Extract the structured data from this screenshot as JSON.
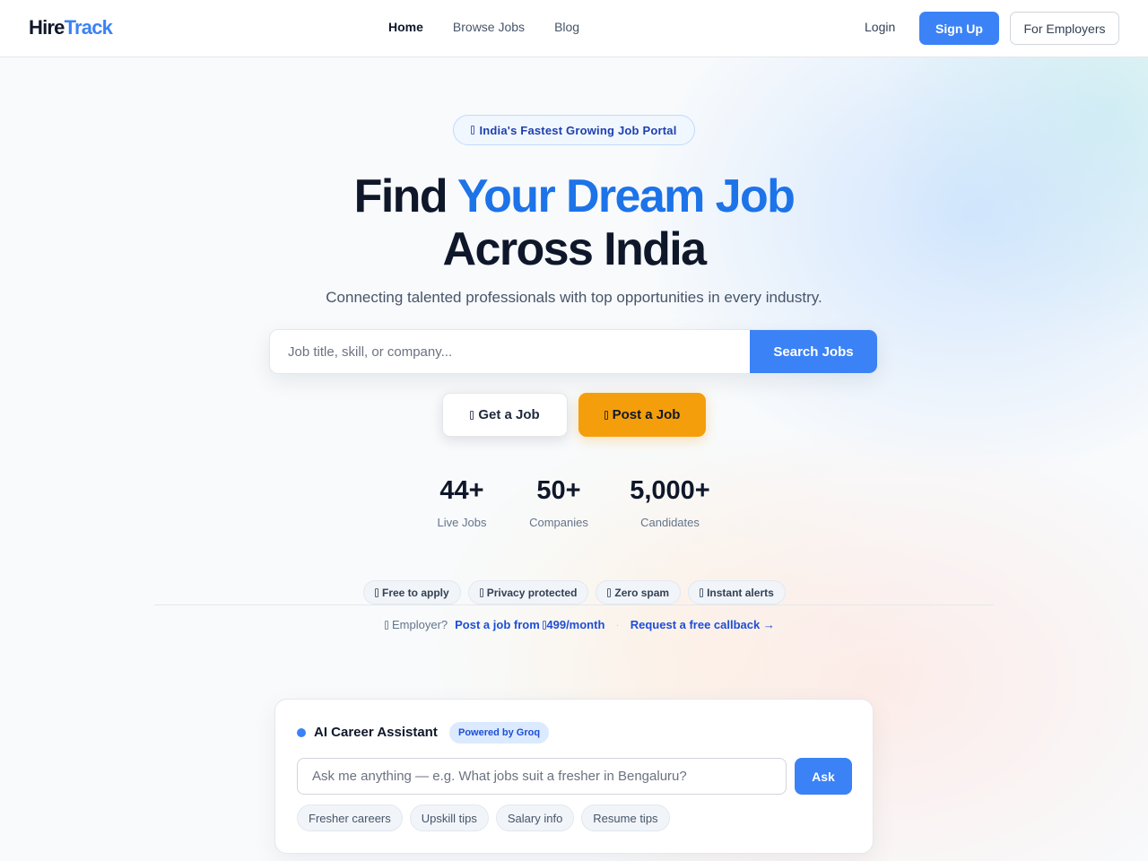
{
  "brand": {
    "part1": "Hire",
    "part2": "Track",
    "accent_color": "#3b82f6"
  },
  "nav": [
    {
      "label": "Home",
      "active": true
    },
    {
      "label": "Browse Jobs",
      "active": false
    },
    {
      "label": "Blog",
      "active": false
    }
  ],
  "header_actions": {
    "login": "Login",
    "signup": "Sign Up",
    "employers": "For Employers"
  },
  "hero": {
    "badge": "India's Fastest Growing Job Portal",
    "title_line1_plain": "Find ",
    "title_line1_accent": "Your Dream Job",
    "title_line2": "Across India",
    "subtitle": "Connecting talented professionals with top opportunities in every industry."
  },
  "search": {
    "placeholder": "Job title, skill, or company...",
    "value": "",
    "button": "Search Jobs"
  },
  "cta": {
    "get_job": "Get a Job",
    "post_job": "Post a Job"
  },
  "stats": [
    {
      "value": "44+",
      "label": "Live Jobs"
    },
    {
      "value": "50+",
      "label": "Companies"
    },
    {
      "value": "5,000+",
      "label": "Candidates"
    }
  ],
  "features": [
    "Free to apply",
    "Privacy protected",
    "Zero spam",
    "Instant alerts"
  ],
  "employer_line": {
    "prefix": "Employer?",
    "post_link_prefix": "Post a job from ",
    "post_link_suffix": "499/month",
    "callback_link": "Request a free callback →"
  },
  "ai_assistant": {
    "title": "AI Career Assistant",
    "badge": "Powered by Groq",
    "placeholder": "Ask me anything — e.g. What jobs suit a fresher in Bengaluru?",
    "value": "",
    "ask_button": "Ask",
    "suggestions": [
      "Fresher careers",
      "Upskill tips",
      "Salary info",
      "Resume tips"
    ]
  },
  "colors": {
    "primary": "#3b82f6",
    "cta_orange": "#f59e0b",
    "title_accent": "#1d73e8"
  }
}
